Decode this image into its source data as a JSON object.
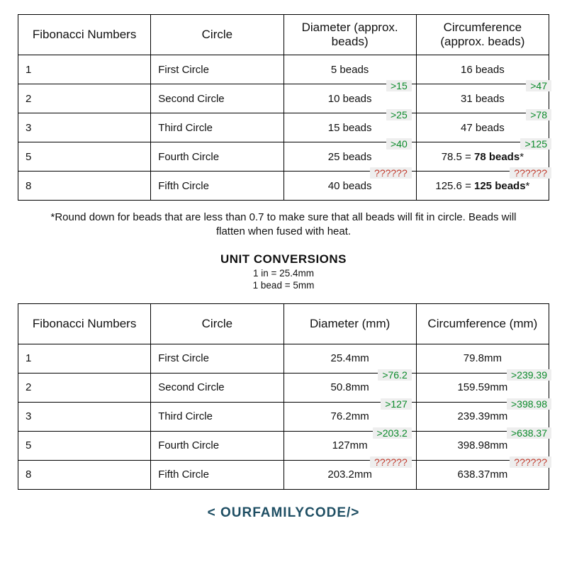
{
  "table1": {
    "headers": [
      "Fibonacci Numbers",
      "Circle",
      "Diameter (approx. beads)",
      "Circumference (approx. beads)"
    ],
    "rows": [
      {
        "fib": "1",
        "circle": "First Circle",
        "diam": "5 beads",
        "circ": "16 beads",
        "a_d": ">15",
        "a_c": ">47"
      },
      {
        "fib": "2",
        "circle": "Second Circle",
        "diam": "10 beads",
        "circ": "31 beads",
        "a_d": ">25",
        "a_c": ">78"
      },
      {
        "fib": "3",
        "circle": "Third Circle",
        "diam": "15 beads",
        "circ": "47 beads",
        "a_d": ">40",
        "a_c": ">125"
      },
      {
        "fib": "5",
        "circle": "Fourth Circle",
        "diam": "25 beads",
        "circ_pre": "78.5 = ",
        "circ_bold": "78 beads",
        "circ_suf": "*",
        "a_d": "??????",
        "a_c": "??????",
        "red": true
      },
      {
        "fib": "8",
        "circle": "Fifth Circle",
        "diam": "40 beads",
        "circ_pre": "125.6 = ",
        "circ_bold": "125 beads",
        "circ_suf": "*"
      }
    ]
  },
  "note": "*Round down for beads that are less than 0.7 to make sure that all beads will fit in circle. Beads will flatten when fused with heat.",
  "section_title": "Unit Conversions",
  "conversions": [
    "1 in = 25.4mm",
    "1 bead = 5mm"
  ],
  "table2": {
    "headers": [
      "Fibonacci Numbers",
      "Circle",
      "Diameter (mm)",
      "Circumference (mm)"
    ],
    "rows": [
      {
        "fib": "1",
        "circle": "First Circle",
        "diam": "25.4mm",
        "circ": "79.8mm",
        "a_d": ">76.2",
        "a_c": ">239.39"
      },
      {
        "fib": "2",
        "circle": "Second Circle",
        "diam": "50.8mm",
        "circ": "159.59mm",
        "a_d": ">127",
        "a_c": ">398.98"
      },
      {
        "fib": "3",
        "circle": "Third Circle",
        "diam": "76.2mm",
        "circ": "239.39mm",
        "a_d": ">203.2",
        "a_c": ">638.37"
      },
      {
        "fib": "5",
        "circle": "Fourth Circle",
        "diam": "127mm",
        "circ": "398.98mm",
        "a_d": "??????",
        "a_c": "??????",
        "red": true
      },
      {
        "fib": "8",
        "circle": "Fifth Circle",
        "diam": "203.2mm",
        "circ": "638.37mm"
      }
    ]
  },
  "footer": {
    "open": "<",
    "brand": " OURFAMILYCODE",
    "mid": "/",
    "close": ">"
  },
  "chart_data": [
    {
      "type": "table",
      "title": "Fibonacci Circle Bead Counts",
      "columns": [
        "Fibonacci Number",
        "Circle",
        "Diameter (beads)",
        "Circumference (beads)"
      ],
      "rows": [
        [
          1,
          "First Circle",
          5,
          16
        ],
        [
          2,
          "Second Circle",
          10,
          31
        ],
        [
          3,
          "Third Circle",
          15,
          47
        ],
        [
          5,
          "Fourth Circle",
          25,
          78
        ],
        [
          8,
          "Fifth Circle",
          40,
          125
        ]
      ],
      "annotations": {
        "diameter_sums_adjacent": [
          15,
          25,
          40
        ],
        "circumference_sums_adjacent": [
          47,
          78,
          125
        ]
      }
    },
    {
      "type": "table",
      "title": "Fibonacci Circle Dimensions (mm)",
      "columns": [
        "Fibonacci Number",
        "Circle",
        "Diameter (mm)",
        "Circumference (mm)"
      ],
      "rows": [
        [
          1,
          "First Circle",
          25.4,
          79.8
        ],
        [
          2,
          "Second Circle",
          50.8,
          159.59
        ],
        [
          3,
          "Third Circle",
          76.2,
          239.39
        ],
        [
          5,
          "Fourth Circle",
          127,
          398.98
        ],
        [
          8,
          "Fifth Circle",
          203.2,
          638.37
        ]
      ],
      "annotations": {
        "diameter_sums_adjacent": [
          76.2,
          127,
          203.2
        ],
        "circumference_sums_adjacent": [
          239.39,
          398.98,
          638.37
        ]
      },
      "unit_conversions": {
        "in_to_mm": 25.4,
        "bead_to_mm": 5
      }
    }
  ]
}
